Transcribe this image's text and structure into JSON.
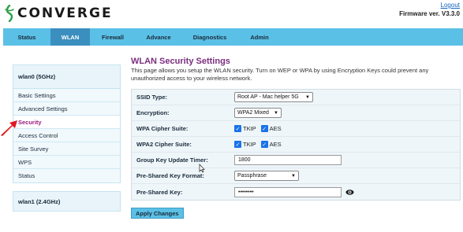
{
  "header": {
    "brand": "CONVERGE",
    "logout": "Logout",
    "firmware": "Firmware ver. V3.3.0"
  },
  "nav": {
    "items": [
      {
        "label": "Status"
      },
      {
        "label": "WLAN"
      },
      {
        "label": "Firewall"
      },
      {
        "label": "Advance"
      },
      {
        "label": "Diagnostics"
      },
      {
        "label": "Admin"
      }
    ],
    "active": "WLAN"
  },
  "sidebar": {
    "group1_title": "wlan0 (5GHz)",
    "items": [
      {
        "label": "Basic Settings"
      },
      {
        "label": "Advanced Settings"
      },
      {
        "label": "Security"
      },
      {
        "label": "Access Control"
      },
      {
        "label": "Site Survey"
      },
      {
        "label": "WPS"
      },
      {
        "label": "Status"
      }
    ],
    "active": "Security",
    "group2_title": "wlan1 (2.4GHz)"
  },
  "page": {
    "title": "WLAN Security Settings",
    "description": "This page allows you setup the WLAN security. Turn on WEP or WPA by using Encryption Keys could prevent any unauthorized access to your wireless network."
  },
  "form": {
    "ssid_type_label": "SSID Type:",
    "ssid_type_value": "Root AP - Mac helper 5G",
    "encryption_label": "Encryption:",
    "encryption_value": "WPA2 Mixed",
    "wpa_cipher_label": "WPA Cipher Suite:",
    "wpa_cipher_options": [
      "TKIP",
      "AES"
    ],
    "wpa_cipher_checked": [
      true,
      true
    ],
    "wpa2_cipher_label": "WPA2 Cipher Suite:",
    "wpa2_cipher_options": [
      "TKIP",
      "AES"
    ],
    "wpa2_cipher_checked": [
      true,
      true
    ],
    "group_key_label": "Group Key Update Timer:",
    "group_key_value": "1800",
    "psk_format_label": "Pre-Shared Key Format:",
    "psk_format_value": "Passphrase",
    "psk_label": "Pre-Shared Key:",
    "psk_value": "••••••••"
  },
  "actions": {
    "apply": "Apply Changes"
  },
  "colors": {
    "nav_bg": "#5bc0e6",
    "nav_active": "#3b8fbf",
    "title": "#7b2d7e",
    "sidebar_active": "#9b1a7c",
    "checkbox": "#1a73e8",
    "pointer_arrow": "#e0171f"
  }
}
